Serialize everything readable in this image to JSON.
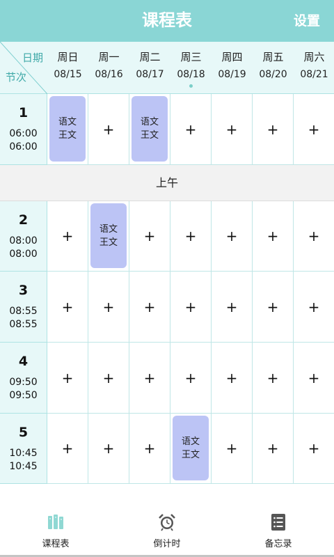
{
  "app": {
    "title": "课程表",
    "settings_label": "设置"
  },
  "header": {
    "corner_date_label": "日期",
    "corner_period_label": "节次",
    "days": [
      {
        "name": "周日",
        "date": "08/15",
        "today": false
      },
      {
        "name": "周一",
        "date": "08/16",
        "today": false
      },
      {
        "name": "周二",
        "date": "08/17",
        "today": false
      },
      {
        "name": "周三",
        "date": "08/18",
        "today": true
      },
      {
        "name": "周四",
        "date": "08/19",
        "today": false
      },
      {
        "name": "周五",
        "date": "08/20",
        "today": false
      },
      {
        "name": "周六",
        "date": "08/21",
        "today": false
      }
    ]
  },
  "add_symbol": "+",
  "section_label": "上午",
  "periods": [
    {
      "num": "1",
      "start": "06:00",
      "end": "06:00"
    },
    {
      "num": "2",
      "start": "08:00",
      "end": "08:00"
    },
    {
      "num": "3",
      "start": "08:55",
      "end": "08:55"
    },
    {
      "num": "4",
      "start": "09:50",
      "end": "09:50"
    },
    {
      "num": "5",
      "start": "10:45",
      "end": "10:45"
    }
  ],
  "courses": [
    {
      "period": 0,
      "day": 0,
      "name": "语文",
      "teacher": "王文"
    },
    {
      "period": 0,
      "day": 2,
      "name": "语文",
      "teacher": "王文"
    },
    {
      "period": 1,
      "day": 1,
      "name": "语文",
      "teacher": "王文"
    },
    {
      "period": 4,
      "day": 3,
      "name": "语文",
      "teacher": "王文"
    }
  ],
  "nav": {
    "schedule_label": "课程表",
    "countdown_label": "倒计时",
    "memo_label": "备忘录",
    "schedule_icon": "books-icon",
    "countdown_icon": "alarm-clock-icon",
    "memo_icon": "notes-list-icon"
  },
  "colors": {
    "accent": "#8ad6d5",
    "header_bg": "#e7f8f8",
    "course_bg": "#bcc4f5",
    "section_bg": "#f2f2f2"
  }
}
